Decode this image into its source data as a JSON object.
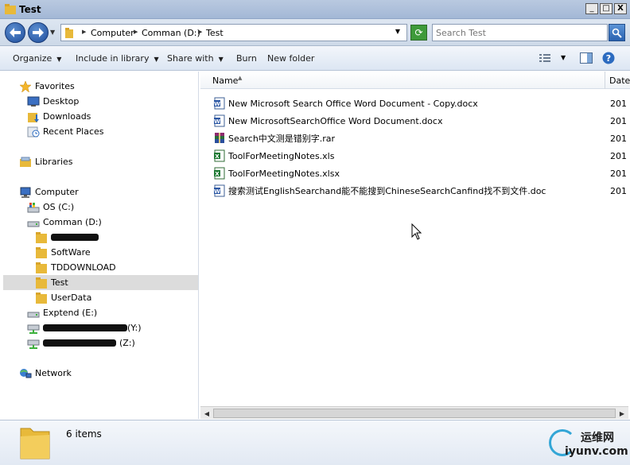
{
  "window": {
    "title": "Test"
  },
  "window_buttons": {
    "minimize": "_",
    "maximize": "□",
    "close": "X"
  },
  "address": {
    "crumbs": [
      "Computer",
      "Comman (D:)",
      "Test"
    ]
  },
  "search": {
    "placeholder": "Search Test"
  },
  "commands": [
    "Organize",
    "Include in library",
    "Share with",
    "Burn",
    "New folder"
  ],
  "nav": {
    "favorites": "Favorites",
    "desktop": "Desktop",
    "downloads": "Downloads",
    "recent": "Recent Places",
    "libraries": "Libraries",
    "computer": "Computer",
    "os": "OS (C:)",
    "comman": "Comman (D:)",
    "software": "SoftWare",
    "tddownload": "TDDOWNLOAD",
    "test": "Test",
    "userdata": "UserData",
    "extend": "Exptend (E:)",
    "net_y_suffix": "(Y:)",
    "net_z_suffix": "(Z:)",
    "network": "Network"
  },
  "columns": {
    "name": "Name",
    "date": "Date"
  },
  "files": [
    {
      "name": "New Microsoft Search Office Word Document - Copy.docx",
      "icon": "word-icon",
      "date": "201"
    },
    {
      "name": "New MicrosoftSearchOffice Word Document.docx",
      "icon": "word-icon",
      "date": "201"
    },
    {
      "name": "Search中文测是错别字.rar",
      "icon": "rar-icon",
      "date": "201"
    },
    {
      "name": "ToolForMeetingNotes.xls",
      "icon": "excel-icon",
      "date": "201"
    },
    {
      "name": "ToolForMeetingNotes.xlsx",
      "icon": "excel-icon",
      "date": "201"
    },
    {
      "name": "搜索测试EnglishSearchand能不能搜到ChineseSearchCanfind找不到文件.doc",
      "icon": "word-icon",
      "date": "201"
    }
  ],
  "status": {
    "count": "6 items"
  },
  "watermark": {
    "cn": "运维网",
    "url": "iyunv.com"
  }
}
